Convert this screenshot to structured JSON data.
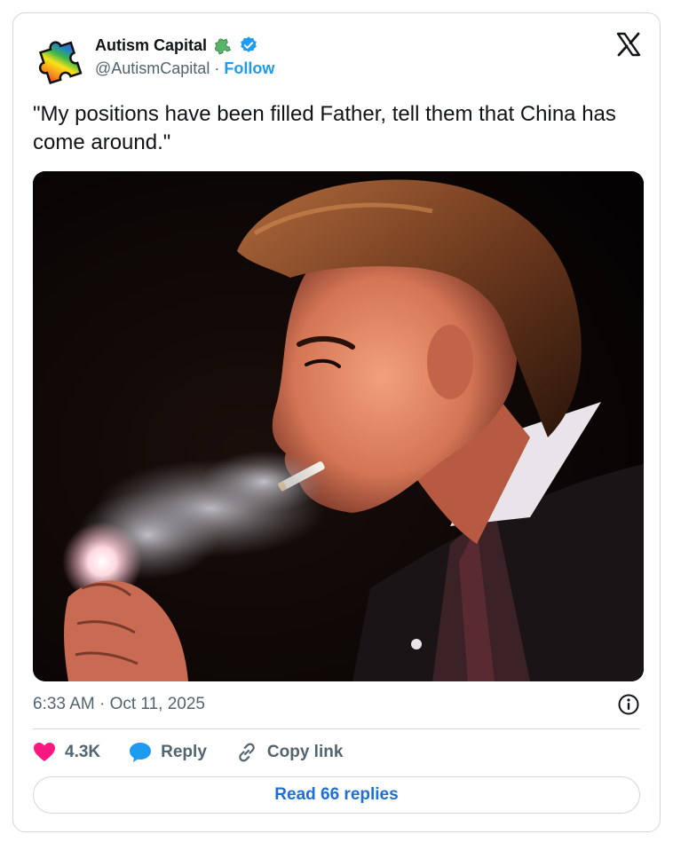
{
  "author": {
    "display_name": "Autism Capital",
    "handle": "@AutismCapital",
    "separator": "·",
    "follow_label": "Follow",
    "verified": true
  },
  "tweet": {
    "text": "\"My positions have been filled Father, tell them that China has come around.\"",
    "timestamp": "6:33 AM · Oct 11, 2025"
  },
  "actions": {
    "likes_count": "4.3K",
    "reply_label": "Reply",
    "copy_link_label": "Copy link",
    "read_replies_label": "Read 66 replies"
  },
  "colors": {
    "accent": "#1d9bf0",
    "like": "#f91880",
    "muted": "#536471",
    "border": "#cfd9de"
  },
  "icons": {
    "avatar": "rainbow-puzzle-piece-icon",
    "affiliate_badge": "green-puzzle-piece-icon",
    "verified_badge": "verified-check-icon",
    "platform_logo": "x-logo-icon",
    "info": "info-icon",
    "like": "heart-icon",
    "reply": "speech-bubble-icon",
    "copy_link": "link-icon"
  }
}
